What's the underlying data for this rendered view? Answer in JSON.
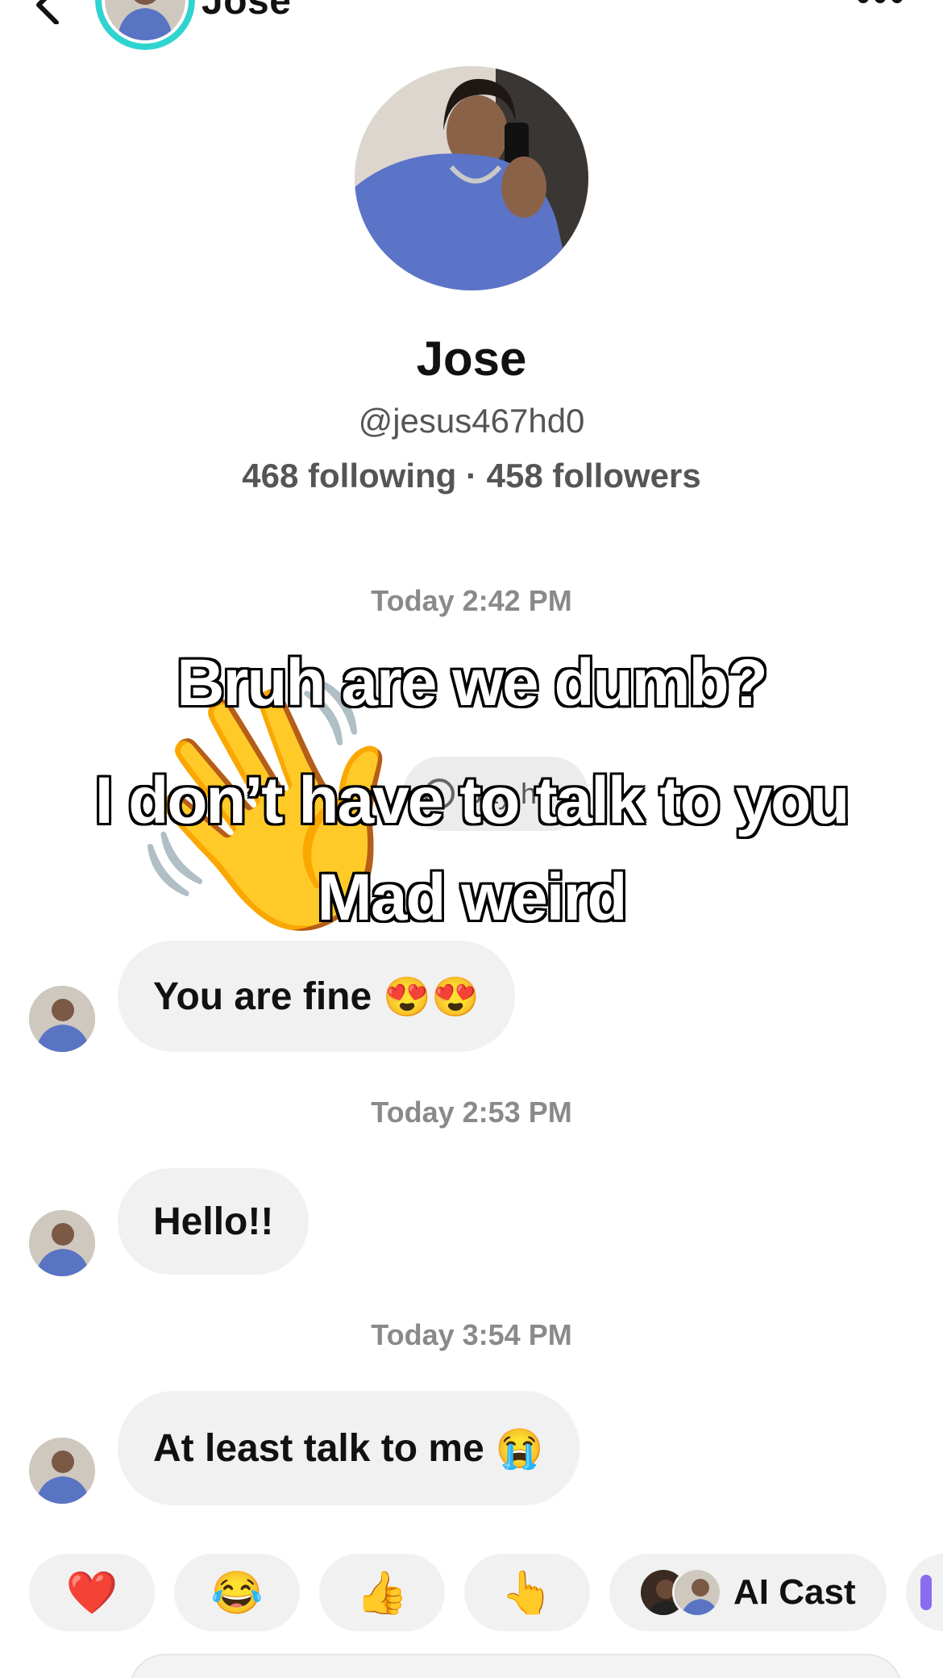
{
  "header": {
    "name": "Jose",
    "back_icon": "chevron-left-icon",
    "more_icon": "more-horizontal-icon",
    "ring_color": "#2fd3d0"
  },
  "profile": {
    "name": "Jose",
    "handle": "@jesus467hd0",
    "stats": "468 following · 458 followers"
  },
  "conversation": {
    "timestamps": [
      "Today 2:42 PM",
      "Today 2:53 PM",
      "Today 3:54 PM"
    ],
    "say_hi_label": "Say hi",
    "messages": [
      {
        "text": "You are fine",
        "emoji": "😍😍"
      },
      {
        "text": "Hello!!",
        "emoji": ""
      },
      {
        "text": "At least talk to me",
        "emoji": "😭"
      }
    ]
  },
  "overlay": {
    "lines": [
      "Bruh are we dumb?",
      "I don’t have to talk to you",
      "Mad weird"
    ],
    "wave_emoji": "👋"
  },
  "quick_replies": {
    "emojis": [
      "❤️",
      "😂",
      "👍",
      "👆"
    ],
    "ai_cast_label": "AI Cast"
  },
  "colors": {
    "bubble_bg": "#f1f1f2",
    "timestamp": "#8a8a8a",
    "accent_ring": "#2fd3d0"
  }
}
